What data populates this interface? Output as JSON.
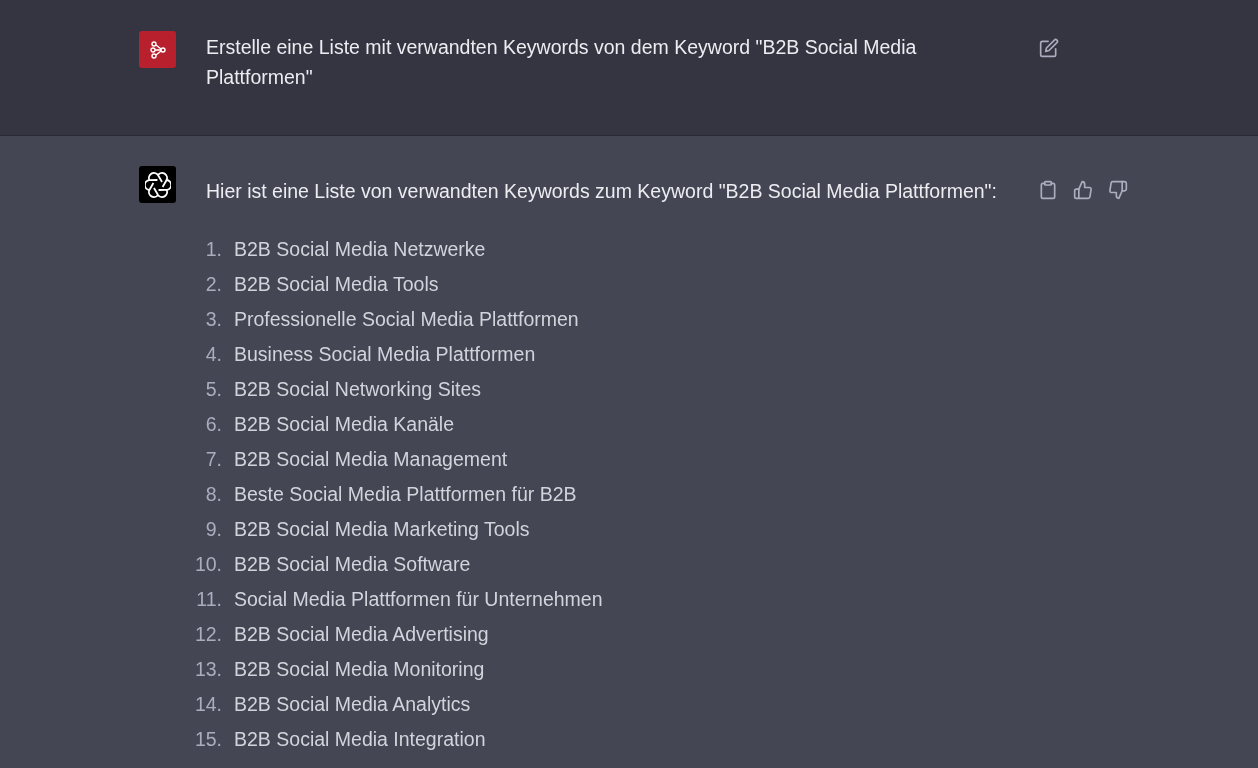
{
  "user_message": {
    "text": "Erstelle eine Liste mit verwandten Keywords von dem Keyword \"B2B Social Media Plattformen\""
  },
  "assistant_message": {
    "intro": "Hier ist eine Liste von verwandten Keywords zum Keyword \"B2B Social Media Plattformen\":",
    "items": [
      {
        "number": "1.",
        "text": "B2B Social Media Netzwerke"
      },
      {
        "number": "2.",
        "text": "B2B Social Media Tools"
      },
      {
        "number": "3.",
        "text": "Professionelle Social Media Plattformen"
      },
      {
        "number": "4.",
        "text": "Business Social Media Plattformen"
      },
      {
        "number": "5.",
        "text": "B2B Social Networking Sites"
      },
      {
        "number": "6.",
        "text": "B2B Social Media Kanäle"
      },
      {
        "number": "7.",
        "text": "B2B Social Media Management"
      },
      {
        "number": "8.",
        "text": "Beste Social Media Plattformen für B2B"
      },
      {
        "number": "9.",
        "text": "B2B Social Media Marketing Tools"
      },
      {
        "number": "10.",
        "text": "B2B Social Media Software"
      },
      {
        "number": "11.",
        "text": "Social Media Plattformen für Unternehmen"
      },
      {
        "number": "12.",
        "text": "B2B Social Media Advertising"
      },
      {
        "number": "13.",
        "text": "B2B Social Media Monitoring"
      },
      {
        "number": "14.",
        "text": "B2B Social Media Analytics"
      },
      {
        "number": "15.",
        "text": "B2B Social Media Integration"
      }
    ]
  }
}
